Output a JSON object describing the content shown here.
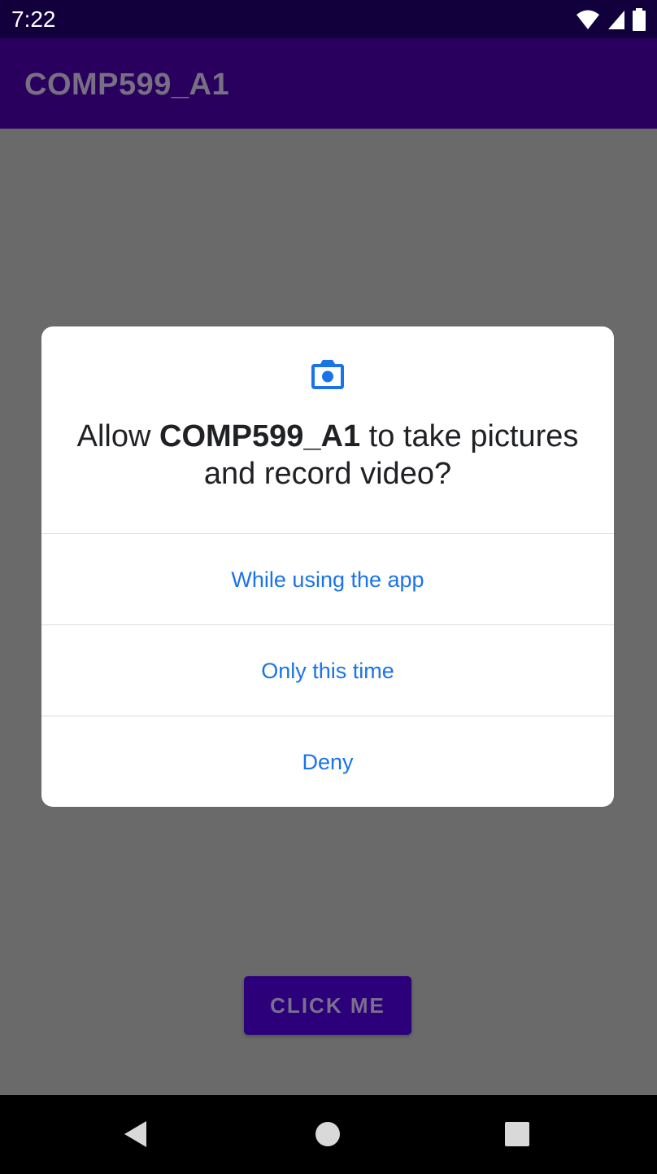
{
  "status_bar": {
    "time": "7:22"
  },
  "app_bar": {
    "title": "COMP599_A1"
  },
  "main": {
    "click_button_label": "CLICK ME"
  },
  "permission_dialog": {
    "icon": "camera-icon",
    "message_prefix": "Allow ",
    "app_name": "COMP599_A1",
    "message_suffix": " to take pictures and record video?",
    "options": [
      "While using the app",
      "Only this time",
      "Deny"
    ]
  },
  "colors": {
    "accent_blue": "#1a73e8",
    "app_bar": "#2a005f",
    "status_bar": "#12003c",
    "button": "#2c007a"
  },
  "nav_bar": {
    "buttons": [
      "back-icon",
      "home-icon",
      "recents-icon"
    ]
  }
}
